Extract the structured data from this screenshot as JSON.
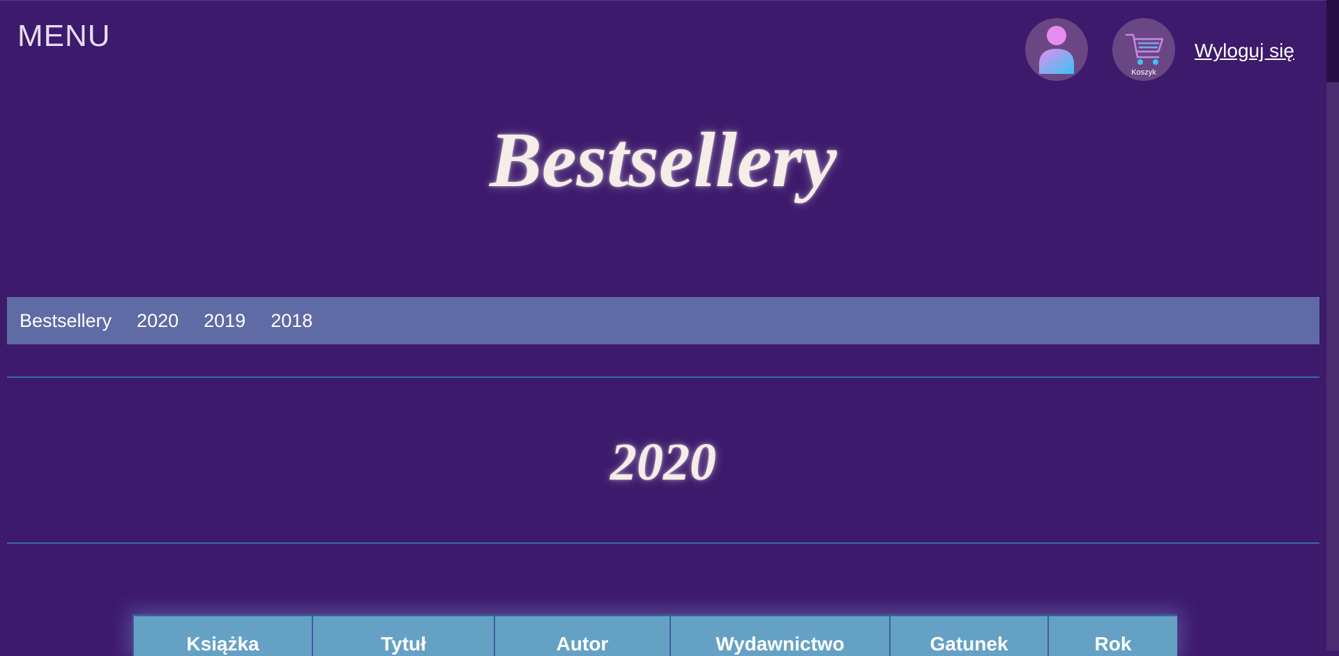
{
  "header": {
    "menu_label": "MENU",
    "cart_caption": "Koszyk",
    "logout_label": "Wyloguj się"
  },
  "page": {
    "title": "Bestsellery"
  },
  "nav": {
    "items": [
      {
        "label": "Bestsellery"
      },
      {
        "label": "2020"
      },
      {
        "label": "2019"
      },
      {
        "label": "2018"
      }
    ]
  },
  "section": {
    "year": "2020"
  },
  "table": {
    "headers": [
      "Książka",
      "Tytuł",
      "Autor",
      "Wydawnictwo",
      "Gatunek",
      "Rok"
    ]
  },
  "icons": {
    "avatar": "user-avatar-icon",
    "cart": "shopping-cart-icon"
  },
  "colors": {
    "background": "#3d1a6b",
    "navbar": "#5f6ba5",
    "table_header": "#65a1c5",
    "divider": "#3a6aa9",
    "title_text": "#f6ece8"
  }
}
